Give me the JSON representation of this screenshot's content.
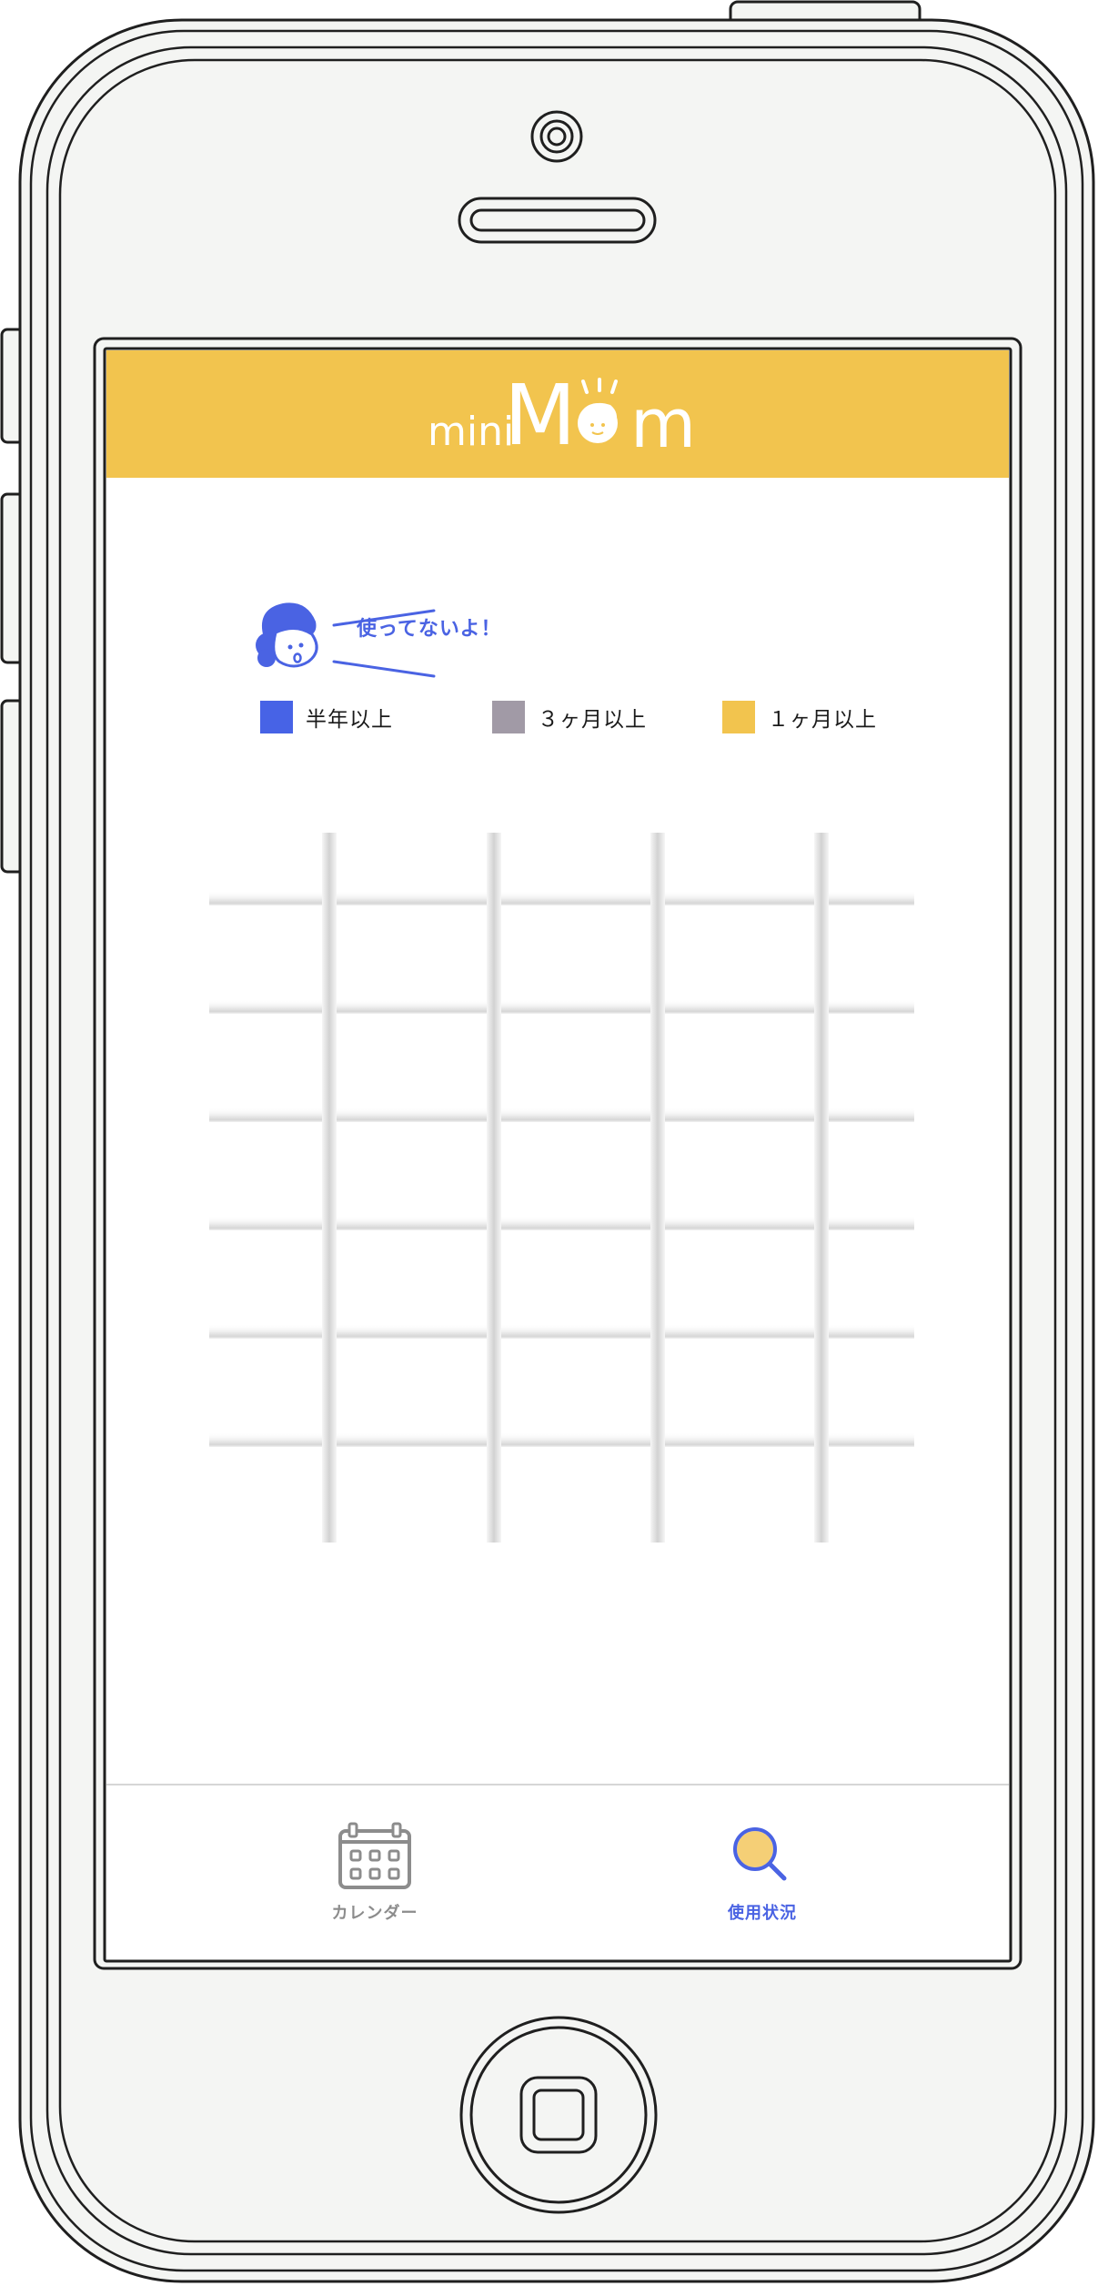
{
  "app": {
    "logo_small": "mini",
    "logo_large_m": "M",
    "logo_tail_m": "m"
  },
  "legend": {
    "bubble_text": "使ってないよ！",
    "items": [
      {
        "label": "半年以上",
        "color": "#4763e6"
      },
      {
        "label": "３ヶ月以上",
        "color": "#a19aa6"
      },
      {
        "label": "１ヶ月以上",
        "color": "#f2c44e"
      }
    ]
  },
  "tabs": [
    {
      "label": "カレンダー",
      "icon": "calendar-icon",
      "active": false,
      "color": "#8c8c8c"
    },
    {
      "label": "使用状況",
      "icon": "search-icon",
      "active": true,
      "color": "#4a63e3"
    }
  ],
  "colors": {
    "accent_yellow": "#f2c44e",
    "accent_blue": "#4a63e3",
    "phone_body": "#f4f5f3"
  }
}
